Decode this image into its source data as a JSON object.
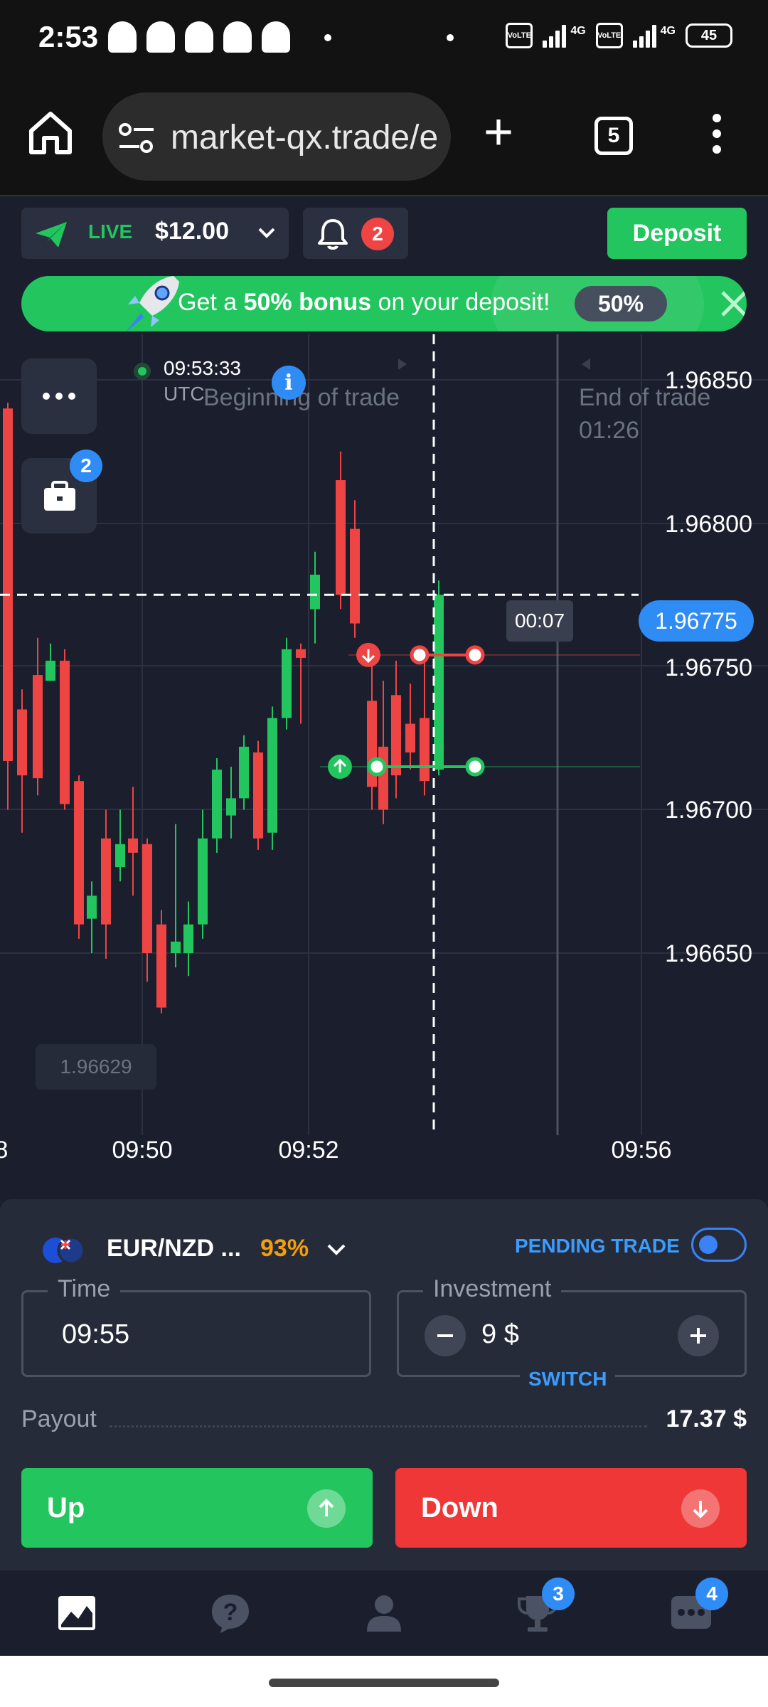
{
  "status_bar": {
    "time": "2:53",
    "volte": "VoLTE",
    "network": "4G",
    "battery": "45"
  },
  "browser": {
    "url": "market-qx.trade/e",
    "tab_count": "5"
  },
  "header": {
    "account_type": "LIVE",
    "balance": "$12.00",
    "notification_count": "2",
    "deposit_label": "Deposit"
  },
  "bonus_banner": {
    "text_prefix": "Get a ",
    "text_bold": "50% bonus",
    "text_suffix": " on your deposit!",
    "badge": "50%",
    "accent_color": "#22c55e"
  },
  "chart": {
    "clock": "09:53:33",
    "timezone": "UTC",
    "beginning_label": "Beginning of trade",
    "end_label": "End of trade",
    "end_countdown": "01:26",
    "countdown": "00:07",
    "current_price": "1.96775",
    "min_price_label": "1.96629",
    "briefcase_count": "2"
  },
  "chart_data": {
    "type": "candlestick",
    "price_ticks": [
      "1.96850",
      "1.96800",
      "1.96750",
      "1.96700",
      "1.96650"
    ],
    "time_ticks": [
      "8",
      "09:50",
      "09:52",
      "09:56"
    ],
    "current_price": 1.96775,
    "trade_up_price": 1.96715,
    "trade_down_price": 1.96754,
    "colors": {
      "up": "#22c55e",
      "down": "#ef4444"
    }
  },
  "trade_panel": {
    "asset": "EUR/NZD ...",
    "payout_pct": "93%",
    "pending_trade_label": "PENDING TRADE",
    "time_label": "Time",
    "time_value": "09:55",
    "investment_label": "Investment",
    "investment_value": "9 $",
    "switch_label": "SWITCH",
    "payout_label": "Payout",
    "payout_value": "17.37 $",
    "up_label": "Up",
    "down_label": "Down"
  },
  "bottom_nav": {
    "items": [
      {
        "icon": "chart-icon"
      },
      {
        "icon": "help-icon"
      },
      {
        "icon": "profile-icon"
      },
      {
        "icon": "trophy-icon",
        "badge": "3"
      },
      {
        "icon": "chat-icon",
        "badge": "4"
      }
    ]
  }
}
